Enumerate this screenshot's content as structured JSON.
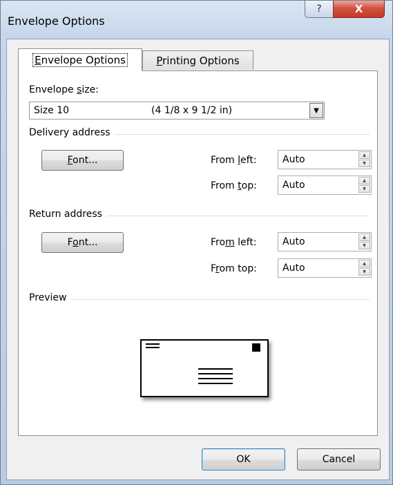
{
  "window": {
    "title": "Envelope Options",
    "help_label": "?",
    "close_label": "X"
  },
  "tabs": [
    {
      "pre": "",
      "key": "E",
      "post": "nvelope Options",
      "active": true
    },
    {
      "pre": "",
      "key": "P",
      "post": "rinting Options",
      "active": false
    }
  ],
  "envelope_size": {
    "label_pre": "Envelope ",
    "label_key": "s",
    "label_post": "ize:",
    "value_name": "Size 10",
    "value_dims": "(4 1/8 x 9 1/2 in)"
  },
  "delivery": {
    "group_label": "Delivery address",
    "font_button": {
      "pre": "",
      "key": "F",
      "post": "ont..."
    },
    "from_left": {
      "pre": "From ",
      "key": "l",
      "post": "eft:",
      "value": "Auto"
    },
    "from_top": {
      "pre": "From ",
      "key": "t",
      "post": "op:",
      "value": "Auto"
    }
  },
  "return": {
    "group_label": "Return address",
    "font_button": {
      "pre": "F",
      "key": "o",
      "post": "nt..."
    },
    "from_left": {
      "pre": "Fro",
      "key": "m",
      "post": " left:",
      "value": "Auto"
    },
    "from_top": {
      "pre": "F",
      "key": "r",
      "post": "om top:",
      "value": "Auto"
    }
  },
  "preview": {
    "group_label": "Preview"
  },
  "footer": {
    "ok_label": "OK",
    "cancel_label": "Cancel"
  }
}
